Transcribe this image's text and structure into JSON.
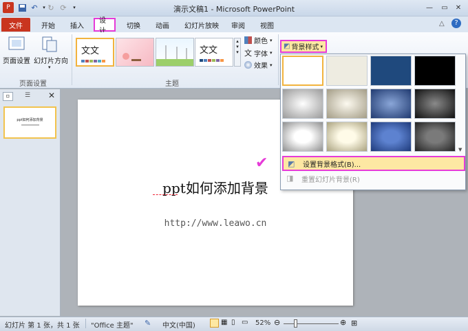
{
  "window": {
    "title": "演示文稿1 - Microsoft PowerPoint"
  },
  "tabs": [
    {
      "label": "文件"
    },
    {
      "label": "开始"
    },
    {
      "label": "插入"
    },
    {
      "label": "设计"
    },
    {
      "label": "切换"
    },
    {
      "label": "动画"
    },
    {
      "label": "幻灯片放映"
    },
    {
      "label": "审阅"
    },
    {
      "label": "视图"
    }
  ],
  "ribbon": {
    "page_setup": {
      "btn_setup": "页面设置",
      "btn_orientation": "幻灯片方向",
      "group": "页面设置"
    },
    "themes": {
      "group": "主题",
      "labels": [
        "文文",
        "",
        "",
        "文文"
      ]
    },
    "theme_options": {
      "colors": "颜色",
      "fonts": "字体",
      "effects": "效果"
    },
    "background_styles": {
      "label": "背景样式"
    }
  },
  "dropdown": {
    "format_background": "设置背景格式(B)...",
    "reset_background": "重置幻灯片背景(R)"
  },
  "slide_thumb": {
    "number": "1",
    "title": "ppt如何添加背景"
  },
  "slide": {
    "title": "ppt如何添加背景",
    "url": "http://www.leawo.cn"
  },
  "status": {
    "slide_info": "幻灯片 第 1 张，共 1 张",
    "theme": "\"Office 主题\"",
    "language": "中文(中国)",
    "zoom": "52%"
  },
  "colors": {
    "accent_pink": "#e63ad8",
    "file_tab": "#c9351f"
  }
}
